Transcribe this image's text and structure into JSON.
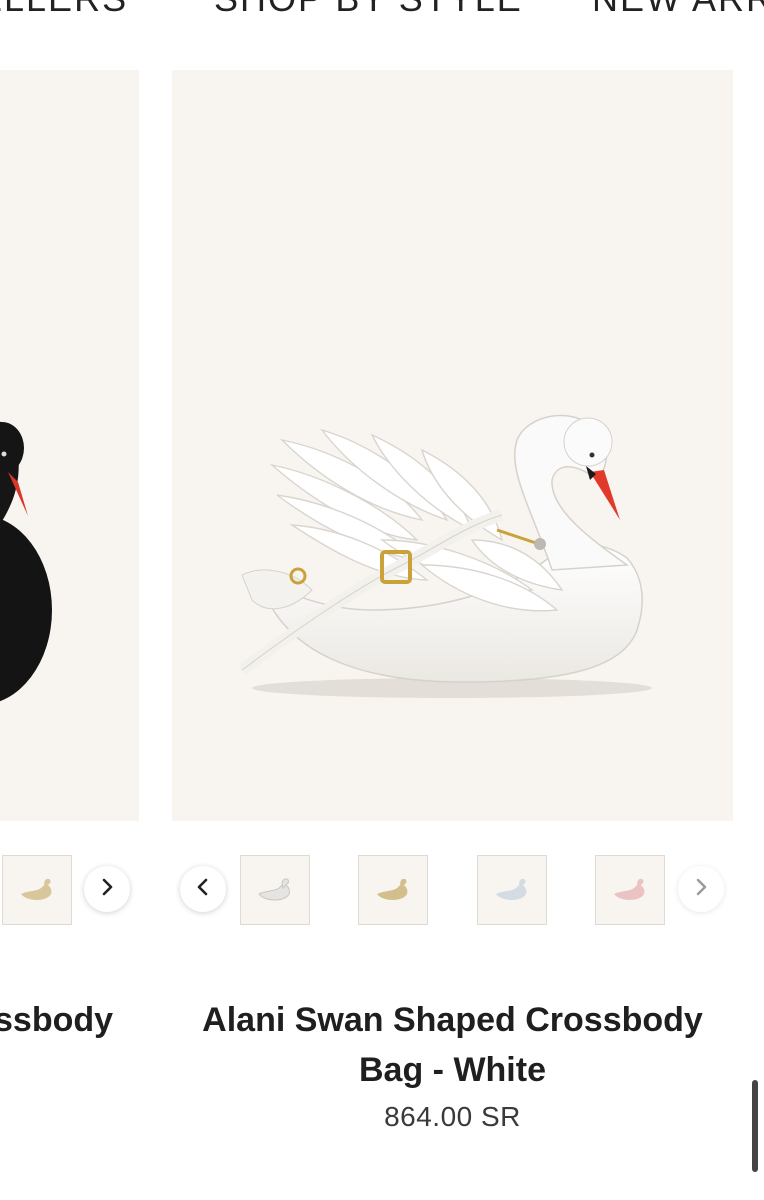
{
  "nav": {
    "items": [
      {
        "label": "ELLERS"
      },
      {
        "label": "SHOP BY STYLE"
      },
      {
        "label": "NEW ARRI"
      }
    ]
  },
  "left_product": {
    "title_visible": "ssbody"
  },
  "product": {
    "title_line1": "Alani Swan Shaped Crossbody",
    "title_line2": "Bag - White",
    "price": "864.00 SR"
  },
  "icons": {
    "prev": "chevron-left-icon",
    "next": "chevron-right-icon"
  },
  "colors": {
    "image_bg": "#f8f5f1",
    "beak": "#e23a2a",
    "hardware": "#c9a23a"
  }
}
